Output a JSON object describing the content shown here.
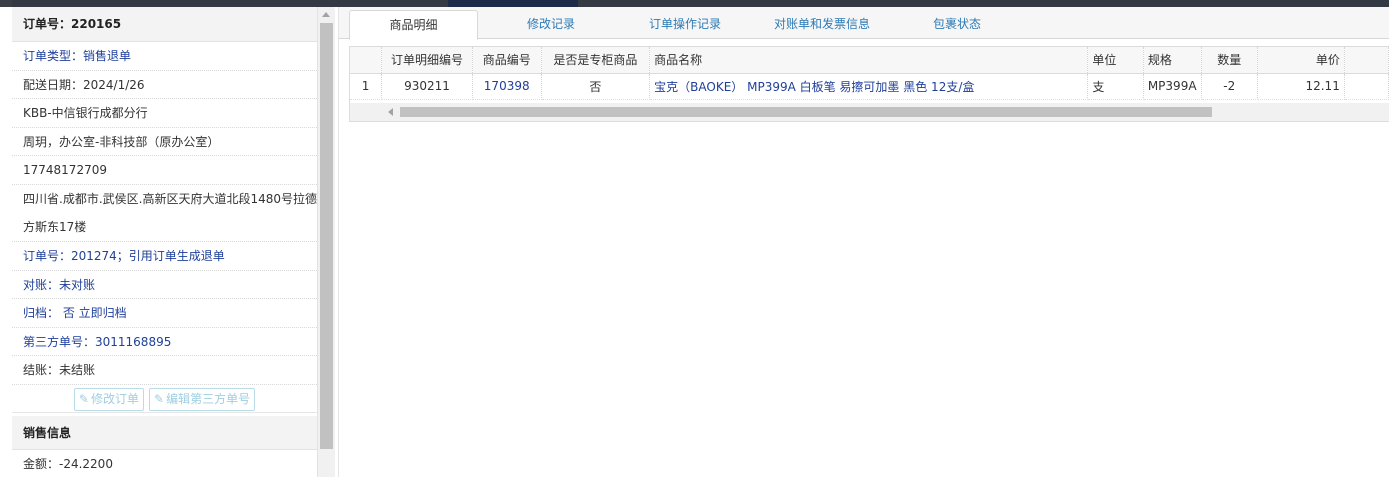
{
  "order": {
    "header": "订单号：220165",
    "type": "订单类型：销售退单",
    "delivery_date": "配送日期：2024/1/26",
    "customer": "KBB-中信银行成都分行",
    "contact": "周玥，办公室-非科技部（原办公室）",
    "phone": "17748172709",
    "address": "四川省.成都市.武侯区.高新区天府大道北段1480号拉德方斯东17楼",
    "ref_order": "订单号：201274；引用订单生成退单",
    "reconcile": "对账：未对账",
    "archive": "归档： 否 立即归档",
    "third_party_no": "第三方单号：3011168895",
    "settlement": "结账：未结账"
  },
  "buttons": {
    "edit_order": "修改订单",
    "edit_third_party": "编辑第三方单号"
  },
  "sales": {
    "header": "销售信息",
    "amount": "金额：-24.2200"
  },
  "tabs": [
    {
      "label": "商品明细",
      "active": true
    },
    {
      "label": "修改记录",
      "active": false
    },
    {
      "label": "订单操作记录",
      "active": false
    },
    {
      "label": "对账单和发票信息",
      "active": false
    },
    {
      "label": "包裹状态",
      "active": false
    }
  ],
  "table": {
    "columns": [
      "",
      "订单明细编号",
      "商品编号",
      "是否是专柜商品",
      "商品名称",
      "单位",
      "规格",
      "数量",
      "单价"
    ],
    "rows": [
      [
        "1",
        "930211",
        "170398",
        "否",
        "宝克（BAOKE） MP399A 白板笔 易擦可加墨 黑色 12支/盒",
        "支",
        "MP399A",
        "-2",
        "12.11"
      ]
    ]
  },
  "colors": {
    "link_blue": "#1f3f9a",
    "tab_blue": "#2d7bb5",
    "topbar": "#333a44"
  }
}
